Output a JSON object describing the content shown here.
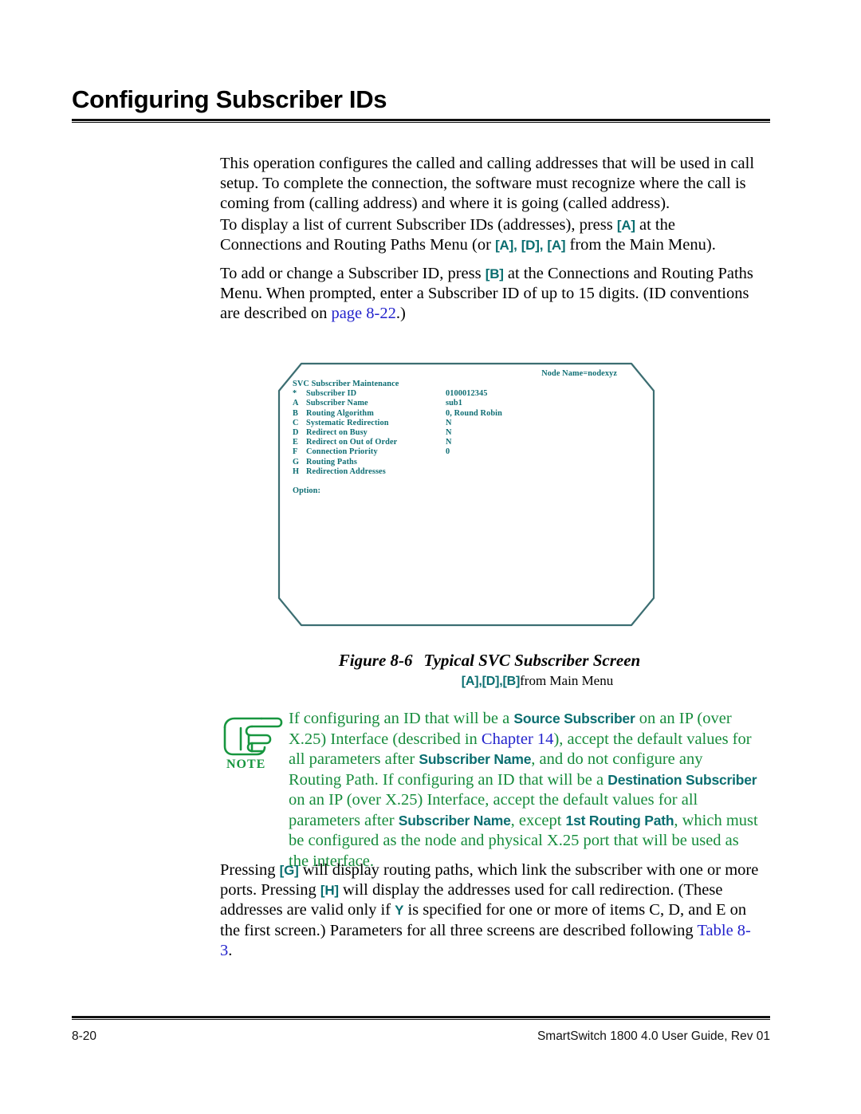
{
  "heading": {
    "title": "Configuring Subscriber IDs"
  },
  "paragraphs": {
    "p1": "This operation configures the called and calling addresses that will be used in call setup. To complete the connection, the software must recognize where the call is coming from (calling address) and where it is going (called address).",
    "p2_a": "To display a list of current Subscriber IDs (addresses), press",
    "p2_key1": "[A]",
    "p2_b": "at the Connections and Routing Paths Menu (or",
    "p2_key2": "[A]",
    "p2_comma1": ",",
    "p2_key3": "[D]",
    "p2_comma2": ",",
    "p2_key4": "[A]",
    "p2_c": "from the Main Menu).",
    "p3_a": "To add or change a Subscriber ID, press",
    "p3_key1": "[B]",
    "p3_b": "at the Connections and Routing Paths Menu. When prompted, enter a Subscriber ID of up to 15 digits. (ID conventions are described on",
    "p3_link": "page 8-22",
    "p3_c": ".)",
    "p4_a": "Pressing",
    "p4_key1": "[G]",
    "p4_b": "will display routing paths, which link the subscriber with one or more ports. Pressing",
    "p4_key2": "[H]",
    "p4_c": "will display the addresses used for call redirection. (These addresses are valid only if",
    "p4_key3": "Y",
    "p4_d": "is specified for one or more of items C, D, and E on the first screen.) Parameters for all three screens are described following",
    "p4_link": "Table 8-3",
    "p4_e": "."
  },
  "terminal": {
    "node_name": "Node Name=nodexyz",
    "screen_title": "SVC Subscriber Maintenance",
    "rows": [
      {
        "key": "*",
        "label": "Subscriber ID",
        "value": "0100012345"
      },
      {
        "key": "A",
        "label": "Subscriber Name",
        "value": "sub1"
      },
      {
        "key": "B",
        "label": "Routing Algorithm",
        "value": "0, Round Robin"
      },
      {
        "key": "C",
        "label": "Systematic Redirection",
        "value": "N"
      },
      {
        "key": "D",
        "label": "Redirect on Busy",
        "value": "N"
      },
      {
        "key": "E",
        "label": "Redirect on Out of Order",
        "value": "N"
      },
      {
        "key": "F",
        "label": "Connection Priority",
        "value": "0"
      },
      {
        "key": "G",
        "label": "Routing Paths",
        "value": ""
      },
      {
        "key": "H",
        "label": "Redirection Addresses",
        "value": ""
      }
    ],
    "prompt": "Option:",
    "text_color": "#0f6e74",
    "border_color": "#3c6e72"
  },
  "figure": {
    "number": "Figure 8-6",
    "title": "Typical SVC Subscriber Screen",
    "path_key1": "[A]",
    "path_sep1": ",",
    "path_key2": "[D]",
    "path_sep2": ",",
    "path_key3": "[B]",
    "path_tail": "from Main Menu"
  },
  "note": {
    "icon_label": "NOTE",
    "t1": "If configuring an ID that will be a",
    "term1": "Source Subscriber",
    "t2": "on an IP (over X.25) Interface (described in",
    "link1": "Chapter 14",
    "t3": "), accept the default values for all parameters after",
    "term2": "Subscriber Name",
    "t4": ", and do not configure any Routing Path. If configuring an ID that will be a",
    "term3": "Destination Subscriber",
    "t5": "on an IP (over X.25) Interface, accept the default values for all parameters after",
    "term4": "Subscriber Name",
    "t6": ", except",
    "term5": "1st Routing Path",
    "t7": ", which must be configured as the node and physical X.25 port that will be used as the interface.",
    "text_color": "#168c3c",
    "term_color": "#0a6e70"
  },
  "footer": {
    "page_number": "8-20",
    "document_title": "SmartSwitch 1800 4.0 User Guide, Rev 01"
  },
  "colors": {
    "key_teal": "#0a6e70",
    "link_blue": "#2222cc",
    "note_green": "#168c3c"
  }
}
